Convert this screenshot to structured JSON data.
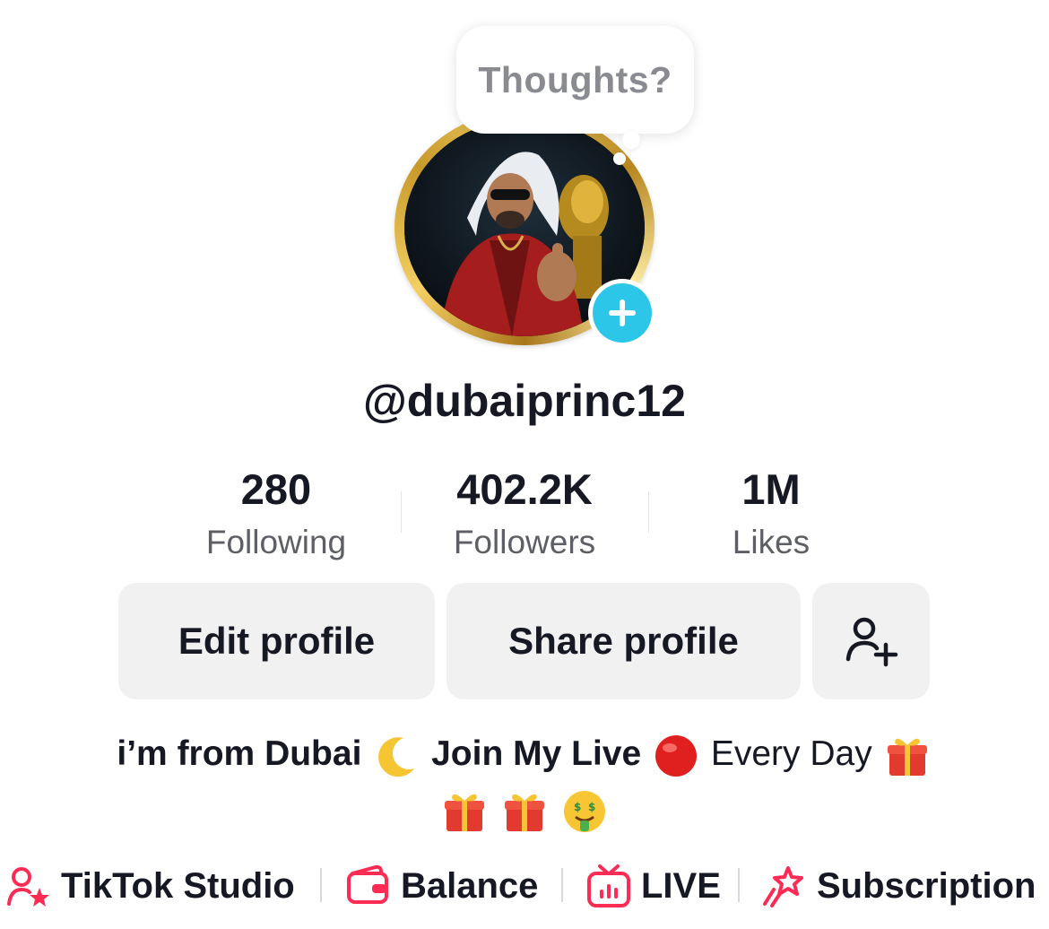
{
  "bubble": {
    "text": "Thoughts?"
  },
  "profile": {
    "username": "@dubaiprinc12"
  },
  "stats": [
    {
      "value": "280",
      "label": "Following"
    },
    {
      "value": "402.2K",
      "label": "Followers"
    },
    {
      "value": "1M",
      "label": "Likes"
    }
  ],
  "buttons": {
    "edit": "Edit profile",
    "share": "Share profile"
  },
  "bio": {
    "part1": "i’m from Dubai",
    "part2": "Join My Live",
    "part3": "Every Day"
  },
  "links": {
    "studio": "TikTok Studio",
    "balance": "Balance",
    "live": "LIVE",
    "subscription": "Subscription"
  },
  "colors": {
    "accent": "#fe2c55",
    "add_button": "#2bc6e8",
    "button_bg": "#f1f1f2",
    "text_primary": "#161823",
    "text_secondary": "#5e5f66"
  },
  "icons": {
    "add_avatar": "plus-icon",
    "add_friend": "add-friend-icon",
    "studio": "creator-star-icon",
    "balance": "wallet-icon",
    "live": "tv-icon",
    "subscription": "star-ribbon-icon",
    "bio_emoji": [
      "crescent-moon-emoji",
      "red-circle-emoji",
      "gift-emoji",
      "gift-emoji",
      "gift-emoji",
      "money-mouth-face-emoji"
    ]
  }
}
